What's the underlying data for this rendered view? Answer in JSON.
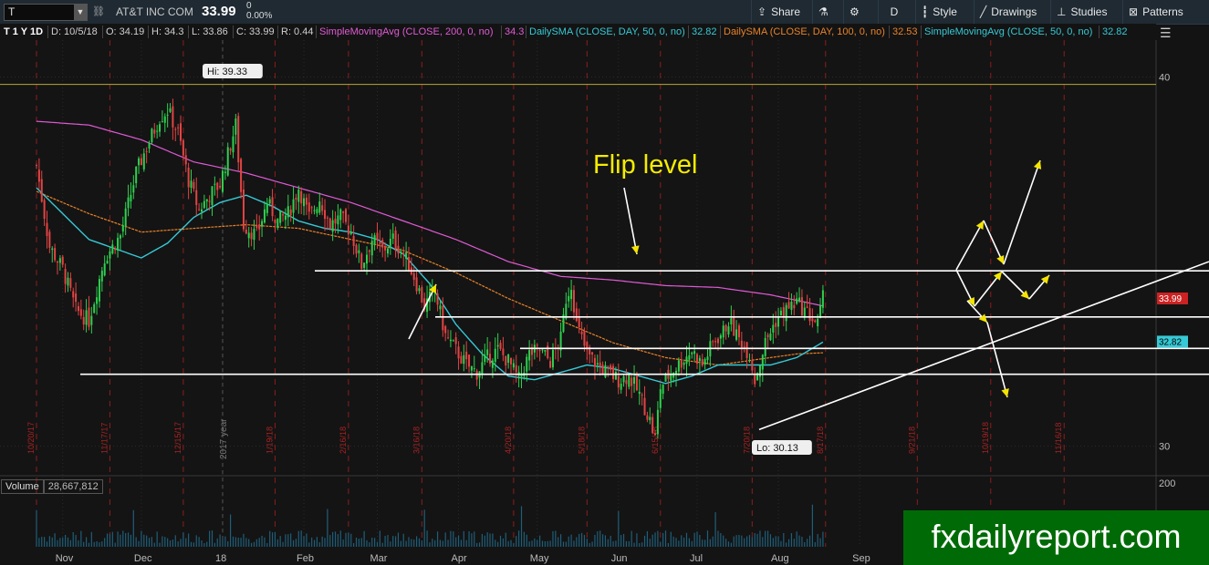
{
  "header": {
    "symbol": "T",
    "company": "AT&T INC COM",
    "last_price": "33.99",
    "change_top": "0",
    "change_pct": "0.00%",
    "buttons": {
      "share": "Share",
      "aggregation": "D",
      "style": "Style",
      "drawings": "Drawings",
      "studies": "Studies",
      "patterns": "Patterns"
    }
  },
  "infobar": {
    "period": "T 1 Y 1D",
    "date": "D: 10/5/18",
    "open": "O: 34.19",
    "high": "H: 34.3",
    "low": "L: 33.86",
    "close": "C: 33.99",
    "range": "R: 0.44",
    "studies": [
      {
        "label": "SimpleMovingAvg (CLOSE, 200, 0, no)",
        "value": "34.3",
        "color": "#e05ad6"
      },
      {
        "label": "DailySMA (CLOSE, DAY, 50, 0, no)",
        "value": "32.82",
        "color": "#36c9d6"
      },
      {
        "label": "DailySMA (CLOSE, DAY, 100, 0, no)",
        "value": "32.53",
        "color": "#e8822a"
      },
      {
        "label": "SimpleMovingAvg (CLOSE, 50, 0, no)",
        "value": "32.82",
        "color": "#36c9d6"
      }
    ]
  },
  "annotations": {
    "flip_level": "Flip level",
    "hi": "Hi: 39.33",
    "lo": "Lo: 30.13",
    "year_marker": "2017 year"
  },
  "price_tags": {
    "last": "33.99",
    "sma": "32.82"
  },
  "volume": {
    "label": "Volume",
    "value": "28,667,812",
    "axis_top": "200"
  },
  "watermark": "fxdailyreport.com",
  "chart_data": {
    "type": "candlestick",
    "title": "",
    "y_ticks": [
      30,
      40
    ],
    "ylim": [
      29.3,
      41
    ],
    "x_months": [
      {
        "label": "Nov",
        "day": 10
      },
      {
        "label": "Dec",
        "day": 40
      },
      {
        "label": "18",
        "day": 71
      },
      {
        "label": "Feb",
        "day": 102
      },
      {
        "label": "Mar",
        "day": 130
      },
      {
        "label": "Apr",
        "day": 161
      },
      {
        "label": "May",
        "day": 191
      },
      {
        "label": "Jun",
        "day": 222
      },
      {
        "label": "Jul",
        "day": 252
      },
      {
        "label": "Aug",
        "day": 283
      },
      {
        "label": "Sep",
        "day": 314
      }
    ],
    "date_markers": [
      {
        "label": "10/20/17",
        "day": 0
      },
      {
        "label": "11/17/17",
        "day": 28
      },
      {
        "label": "12/15/17",
        "day": 56
      },
      {
        "label": "1/19/18",
        "day": 91
      },
      {
        "label": "2/16/18",
        "day": 119
      },
      {
        "label": "3/16/18",
        "day": 147
      },
      {
        "label": "4/20/18",
        "day": 182
      },
      {
        "label": "5/18/18",
        "day": 210
      },
      {
        "label": "6/15/18",
        "day": 238
      },
      {
        "label": "7/20/18",
        "day": 273
      },
      {
        "label": "8/17/18",
        "day": 301
      },
      {
        "label": "9/21/18",
        "day": 336
      },
      {
        "label": "10/19/18",
        "day": 364
      },
      {
        "label": "11/16/18",
        "day": 392
      }
    ],
    "close_path": [
      [
        0,
        37.6
      ],
      [
        5,
        35.4
      ],
      [
        10,
        34.8
      ],
      [
        15,
        33.7
      ],
      [
        20,
        33.4
      ],
      [
        26,
        35.1
      ],
      [
        32,
        35.7
      ],
      [
        38,
        37.4
      ],
      [
        42,
        38.1
      ],
      [
        47,
        38.9
      ],
      [
        50,
        39.1
      ],
      [
        54,
        38.5
      ],
      [
        58,
        37.2
      ],
      [
        62,
        36.4
      ],
      [
        66,
        36.8
      ],
      [
        70,
        37.1
      ],
      [
        73,
        37.9
      ],
      [
        76,
        38.7
      ],
      [
        79,
        36.0
      ],
      [
        84,
        35.7
      ],
      [
        88,
        36.6
      ],
      [
        92,
        36.1
      ],
      [
        96,
        36.3
      ],
      [
        100,
        37.0
      ],
      [
        104,
        36.2
      ],
      [
        108,
        36.7
      ],
      [
        112,
        36.0
      ],
      [
        116,
        36.2
      ],
      [
        120,
        35.8
      ],
      [
        124,
        34.9
      ],
      [
        128,
        35.6
      ],
      [
        132,
        35.3
      ],
      [
        136,
        35.6
      ],
      [
        140,
        35.2
      ],
      [
        144,
        34.6
      ],
      [
        148,
        33.8
      ],
      [
        152,
        34.2
      ],
      [
        156,
        33.0
      ],
      [
        160,
        32.6
      ],
      [
        164,
        32.2
      ],
      [
        168,
        32.0
      ],
      [
        172,
        32.4
      ],
      [
        176,
        32.6
      ],
      [
        180,
        32.3
      ],
      [
        184,
        31.8
      ],
      [
        188,
        32.5
      ],
      [
        192,
        32.6
      ],
      [
        196,
        32.3
      ],
      [
        200,
        32.9
      ],
      [
        202,
        34.0
      ],
      [
        204,
        34.4
      ],
      [
        206,
        33.3
      ],
      [
        210,
        32.5
      ],
      [
        214,
        32.2
      ],
      [
        218,
        32.0
      ],
      [
        222,
        31.8
      ],
      [
        226,
        31.9
      ],
      [
        230,
        31.4
      ],
      [
        234,
        30.7
      ],
      [
        236,
        30.2
      ],
      [
        238,
        31.6
      ],
      [
        242,
        32.0
      ],
      [
        246,
        32.3
      ],
      [
        250,
        32.6
      ],
      [
        254,
        32.2
      ],
      [
        258,
        32.8
      ],
      [
        262,
        33.1
      ],
      [
        264,
        33.4
      ],
      [
        268,
        32.9
      ],
      [
        272,
        32.5
      ],
      [
        274,
        31.8
      ],
      [
        278,
        32.8
      ],
      [
        282,
        33.4
      ],
      [
        286,
        33.7
      ],
      [
        290,
        33.9
      ],
      [
        294,
        33.6
      ],
      [
        298,
        33.3
      ],
      [
        300,
        34.0
      ]
    ],
    "sma200": [
      [
        0,
        38.8
      ],
      [
        20,
        38.7
      ],
      [
        40,
        38.3
      ],
      [
        60,
        37.7
      ],
      [
        80,
        37.4
      ],
      [
        100,
        37.0
      ],
      [
        120,
        36.6
      ],
      [
        140,
        36.1
      ],
      [
        160,
        35.6
      ],
      [
        180,
        35.0
      ],
      [
        200,
        34.6
      ],
      [
        220,
        34.5
      ],
      [
        240,
        34.35
      ],
      [
        260,
        34.3
      ],
      [
        280,
        34.1
      ],
      [
        300,
        33.8
      ]
    ],
    "sma50": [
      [
        0,
        37.0
      ],
      [
        20,
        35.6
      ],
      [
        40,
        35.1
      ],
      [
        50,
        35.5
      ],
      [
        60,
        36.2
      ],
      [
        70,
        36.6
      ],
      [
        80,
        36.8
      ],
      [
        90,
        36.5
      ],
      [
        100,
        36.1
      ],
      [
        110,
        35.9
      ],
      [
        120,
        35.8
      ],
      [
        130,
        35.6
      ],
      [
        140,
        35.2
      ],
      [
        150,
        34.4
      ],
      [
        160,
        33.3
      ],
      [
        170,
        32.5
      ],
      [
        180,
        31.9
      ],
      [
        190,
        31.8
      ],
      [
        200,
        32.0
      ],
      [
        210,
        32.2
      ],
      [
        220,
        32.1
      ],
      [
        230,
        31.9
      ],
      [
        240,
        31.7
      ],
      [
        250,
        31.9
      ],
      [
        260,
        32.2
      ],
      [
        270,
        32.2
      ],
      [
        280,
        32.2
      ],
      [
        290,
        32.4
      ],
      [
        300,
        32.82
      ]
    ],
    "sma100": [
      [
        0,
        36.9
      ],
      [
        20,
        36.3
      ],
      [
        40,
        35.8
      ],
      [
        60,
        35.9
      ],
      [
        80,
        36.0
      ],
      [
        100,
        35.9
      ],
      [
        120,
        35.6
      ],
      [
        140,
        35.3
      ],
      [
        160,
        34.7
      ],
      [
        180,
        34.0
      ],
      [
        200,
        33.4
      ],
      [
        220,
        32.8
      ],
      [
        240,
        32.4
      ],
      [
        260,
        32.2
      ],
      [
        270,
        32.3
      ],
      [
        280,
        32.4
      ],
      [
        290,
        32.5
      ],
      [
        300,
        32.53
      ]
    ],
    "colors": {
      "up": "#2fd04f",
      "down": "#e24444",
      "sma200": "#e05ad6",
      "sma50": "#36c9d6",
      "sma100": "#e8822a"
    }
  }
}
